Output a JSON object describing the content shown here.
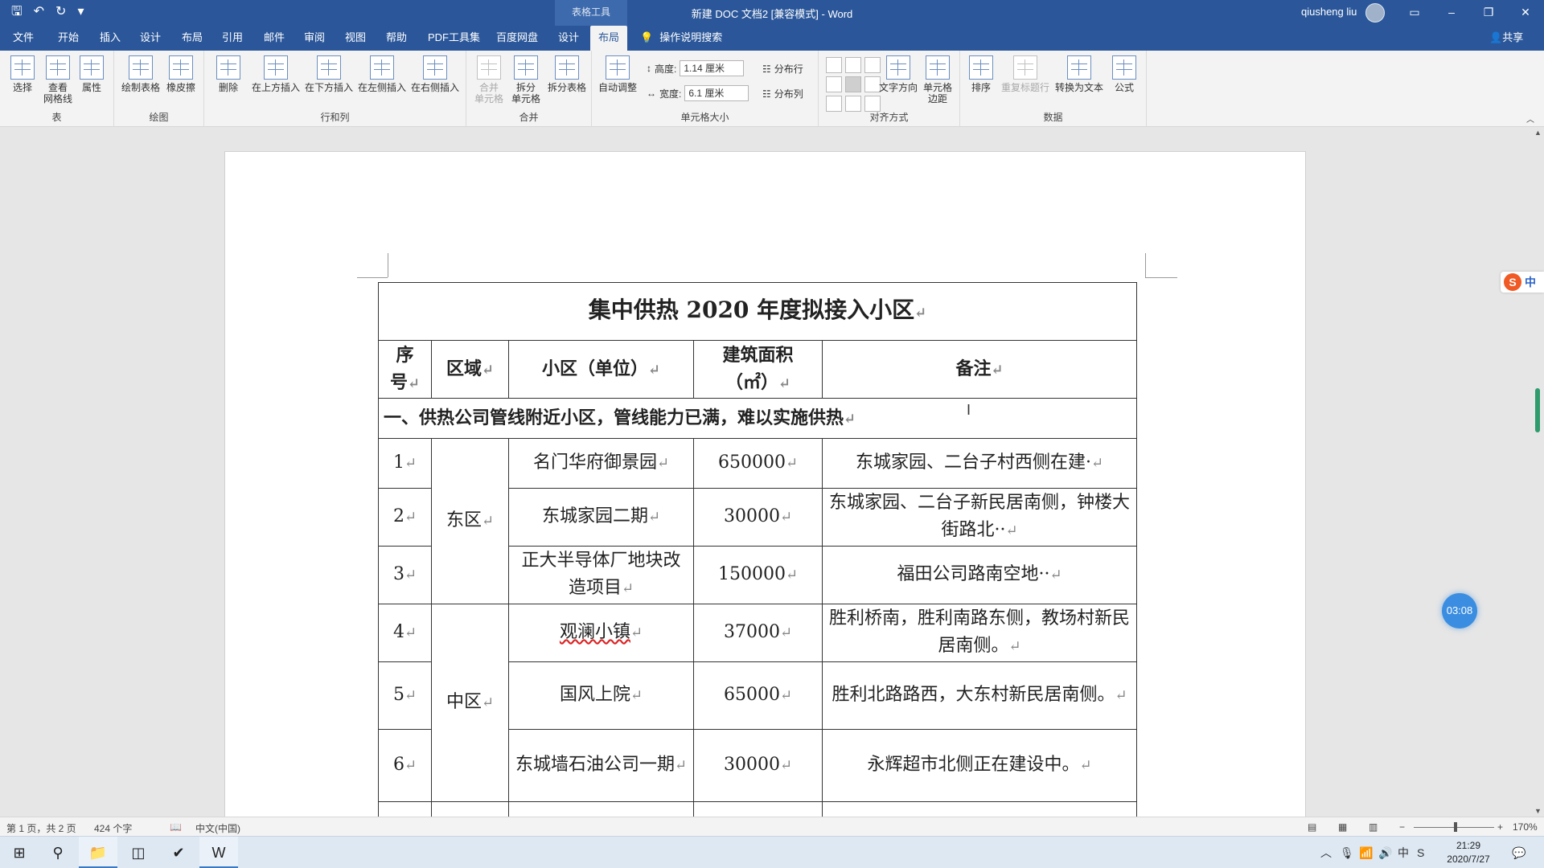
{
  "titlebar": {
    "context_tab": "表格工具",
    "doc_title": "新建 DOC 文档2 [兼容模式]  -  Word",
    "user_name": "qiusheng liu",
    "qat_customize": "▾"
  },
  "tabs": [
    {
      "label": "文件"
    },
    {
      "label": "开始"
    },
    {
      "label": "插入"
    },
    {
      "label": "设计"
    },
    {
      "label": "布局"
    },
    {
      "label": "引用"
    },
    {
      "label": "邮件"
    },
    {
      "label": "审阅"
    },
    {
      "label": "视图"
    },
    {
      "label": "帮助"
    },
    {
      "label": "PDF工具集"
    },
    {
      "label": "百度网盘"
    },
    {
      "label": "设计"
    },
    {
      "label": "布局"
    }
  ],
  "tellme": {
    "label": "操作说明搜索"
  },
  "share": {
    "label": "共享"
  },
  "ribbon": {
    "groups": {
      "table": "表",
      "draw": "绘图",
      "rows_cols": "行和列",
      "merge": "合并",
      "cell_size": "单元格大小",
      "alignment": "对齐方式",
      "data": "数据"
    },
    "buttons": {
      "select": "选择",
      "gridlines_1": "查看",
      "gridlines_2": "网格线",
      "properties": "属性",
      "draw_table": "绘制表格",
      "eraser": "橡皮擦",
      "delete": "删除",
      "insert_above": "在上方插入",
      "insert_below": "在下方插入",
      "insert_left": "在左侧插入",
      "insert_right": "在右侧插入",
      "merge_cells_1": "合并",
      "merge_cells_2": "单元格",
      "split_cells_1": "拆分",
      "split_cells_2": "单元格",
      "split_table": "拆分表格",
      "autofit": "自动调整",
      "height_label": "高度:",
      "height_value": "1.14 厘米",
      "width_label": "宽度:",
      "width_value": "6.1 厘米",
      "distribute_rows": "分布行",
      "distribute_cols": "分布列",
      "text_direction": "文字方向",
      "cell_margins_1": "单元格",
      "cell_margins_2": "边距",
      "sort": "排序",
      "repeat_header": "重复标题行",
      "convert_text": "转换为文本",
      "formula": "公式"
    }
  },
  "document": {
    "table_title": "集中供热 2020 年度拟接入小区",
    "headers": {
      "seq_1": "序",
      "seq_2": "号",
      "region": "区域",
      "community": "小区（单位）",
      "area_1": "建筑面积",
      "area_2": "（㎡）",
      "notes": "备注"
    },
    "section1": "一、供热公司管线附近小区，管线能力已满，难以实施供热",
    "regions": {
      "east": "东区",
      "central": "中区"
    },
    "rows": [
      {
        "seq": "1",
        "community": "名门华府御景园",
        "area": "650000",
        "note": "东城家园、二台子村西侧在建·"
      },
      {
        "seq": "2",
        "community": "东城家园二期",
        "area": "30000",
        "note": "东城家园、二台子新民居南侧，钟楼大街路北··"
      },
      {
        "seq": "3",
        "community": "正大半导体厂地块改造项目",
        "area": "150000",
        "note": "福田公司路南空地··"
      },
      {
        "seq": "4",
        "community": "观澜小镇",
        "area": "37000",
        "note": "胜利桥南，胜利南路东侧，教场村新民居南侧。"
      },
      {
        "seq": "5",
        "community": "国风上院",
        "area": "65000",
        "note": "胜利北路路西，大东村新民居南侧。"
      },
      {
        "seq": "6",
        "community": "东城墙石油公司一期",
        "area": "30000",
        "note": "永辉超市北侧正在建设中。"
      }
    ],
    "para_mark": "↵"
  },
  "overlays": {
    "ime_logo": "S",
    "ime_mode": "中",
    "timer": "03:08"
  },
  "statusbar": {
    "page": "第 1 页，共 2 页",
    "words": "424 个字",
    "language": "中文(中国)",
    "zoom_minus": "−",
    "zoom_plus": "+",
    "zoom": "170%"
  },
  "taskbar": {
    "clock_time": "21:29",
    "clock_date": "2020/7/27"
  },
  "colors": {
    "word_blue": "#2b579a",
    "ribbon_bg": "#f3f3f3",
    "doc_bg": "#e6e6e6",
    "scroll_thumb": "#2e9c6c"
  }
}
